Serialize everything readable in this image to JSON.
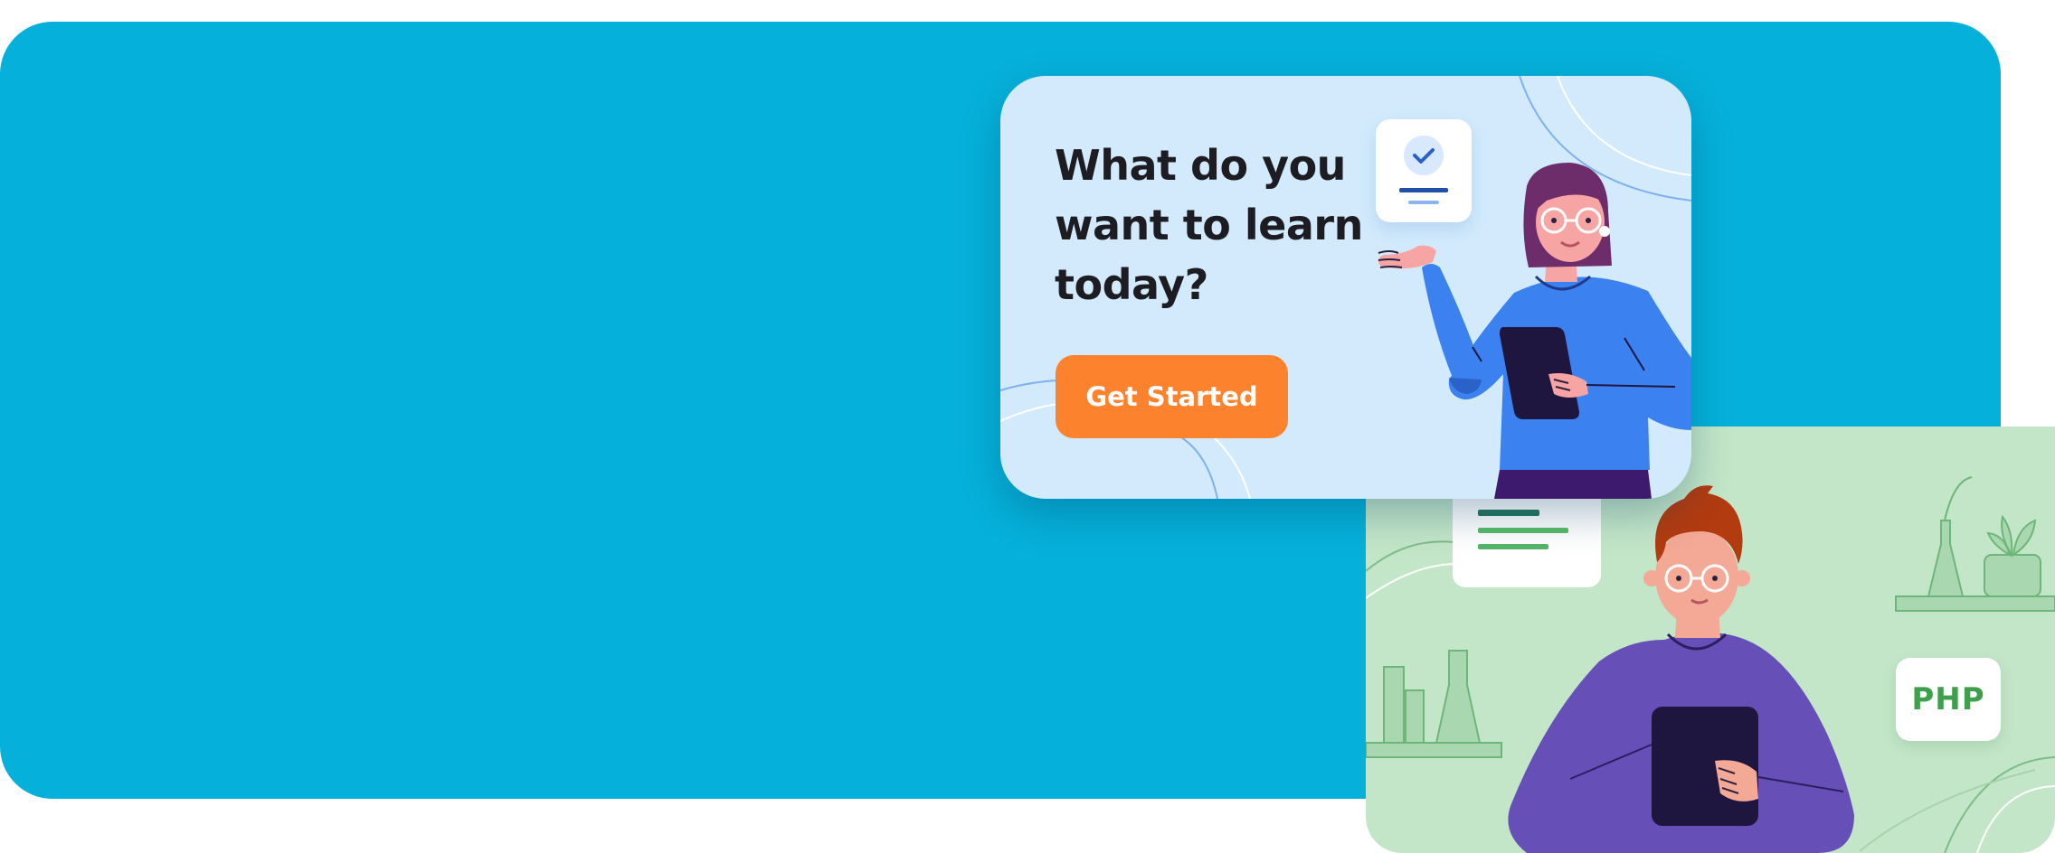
{
  "promo": {
    "headline_lines": [
      "What do you",
      "want to learn",
      "today?"
    ],
    "cta_label": "Get Started"
  },
  "badges": {
    "php": "PHP"
  },
  "colors": {
    "hero_background": "#05b1da",
    "card_blue": "#d2eafc",
    "card_green": "#c3e6c8",
    "cta": "#fd822d",
    "php_text": "#3fa04c"
  },
  "icons": {
    "document_check": "document-check-icon"
  }
}
